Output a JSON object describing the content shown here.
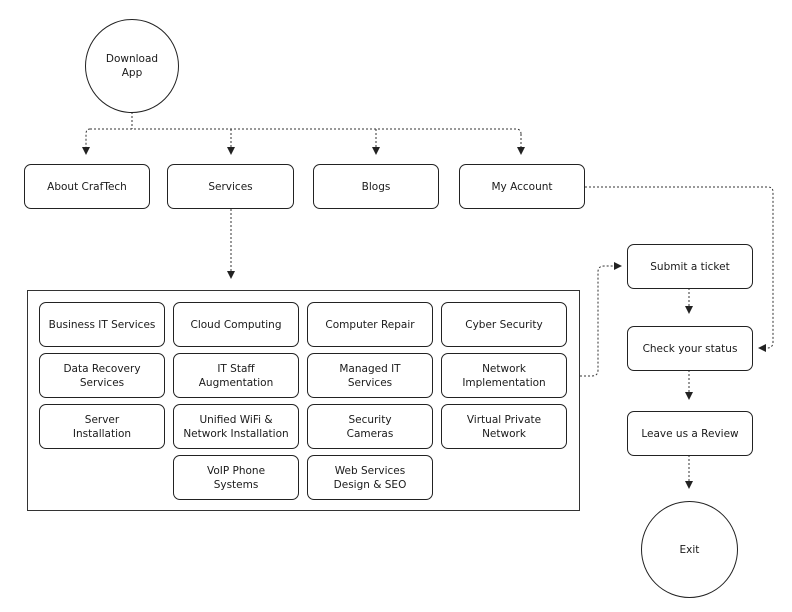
{
  "diagram": {
    "start": {
      "label": "Download\nApp"
    },
    "nav": [
      {
        "label": "About CrafTech"
      },
      {
        "label": "Services"
      },
      {
        "label": "Blogs"
      },
      {
        "label": "My Account"
      }
    ],
    "services": [
      {
        "label": "Business IT Services"
      },
      {
        "label": "Cloud Computing"
      },
      {
        "label": "Computer Repair"
      },
      {
        "label": "Cyber Security"
      },
      {
        "label": "Data Recovery\nServices"
      },
      {
        "label": "IT Staff\nAugmentation"
      },
      {
        "label": "Managed IT\nServices"
      },
      {
        "label": "Network\nImplementation"
      },
      {
        "label": "Server\nInstallation"
      },
      {
        "label": "Unified WiFi &\nNetwork Installation"
      },
      {
        "label": "Security\nCameras"
      },
      {
        "label": "Virtual Private\nNetwork"
      },
      {
        "label": "VoIP Phone\nSystems"
      },
      {
        "label": "Web Services\nDesign & SEO"
      }
    ],
    "support_flow": [
      {
        "label": "Submit a ticket"
      },
      {
        "label": "Check your status"
      },
      {
        "label": "Leave us a Review"
      }
    ],
    "end": {
      "label": "Exit"
    }
  }
}
